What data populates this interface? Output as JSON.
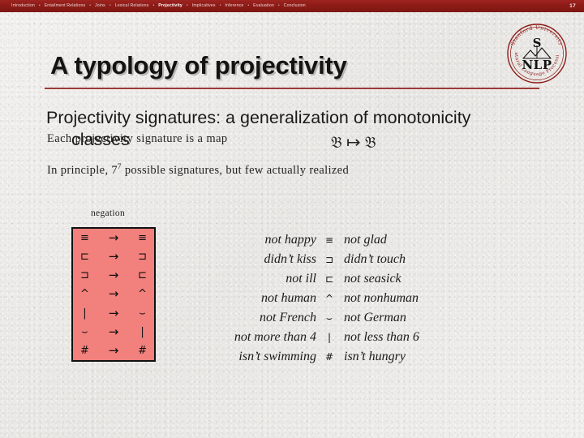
{
  "topbar": {
    "nav_items": [
      {
        "label": "Introduction",
        "active": false
      },
      {
        "label": "Entailment Relations",
        "active": false
      },
      {
        "label": "Joins",
        "active": false
      },
      {
        "label": "Lexical Relations",
        "active": false
      },
      {
        "label": "Projectivity",
        "active": true
      },
      {
        "label": "Implicatives",
        "active": false
      },
      {
        "label": "Inference",
        "active": false
      },
      {
        "label": "Evaluation",
        "active": false
      },
      {
        "label": "Conclusion",
        "active": false
      }
    ],
    "separator": "•",
    "page_number": "17"
  },
  "logo": {
    "name": "stanford-nlp-logo",
    "top_arc_text": "Stanford University",
    "bottom_arc_text": "Natural Language Processing",
    "letter_top": "S",
    "letters_bottom": "NLP"
  },
  "title": "A typology of projectivity",
  "body": {
    "heading_line1": "Projectivity signatures: a generalization of monotonicity",
    "heading_line2": "classes",
    "line_each": "Each projectivity signature is a map",
    "map_left": "𝔅",
    "map_arrow": "↦",
    "map_right": "𝔅",
    "line_principle_pre": "In principle, 7",
    "line_principle_sup": "7",
    "line_principle_post": " possible signatures, but few actually realized"
  },
  "diagram": {
    "label": "negation",
    "box_color": "#f2807c",
    "arrow": "→",
    "rows": [
      {
        "source": "≡",
        "target": "≡"
      },
      {
        "source": "⊏",
        "target": "⊐"
      },
      {
        "source": "⊐",
        "target": "⊏"
      },
      {
        "source": "^",
        "target": "^"
      },
      {
        "source": "|",
        "target": "⌣"
      },
      {
        "source": "⌣",
        "target": "|"
      },
      {
        "source": "#",
        "target": "#"
      }
    ]
  },
  "examples": {
    "rows": [
      {
        "relation": "≡",
        "left": "not happy",
        "right": "not glad"
      },
      {
        "relation": "⊐",
        "left": "didn’t kiss",
        "right": "didn’t touch"
      },
      {
        "relation": "⊏",
        "left": "not ill",
        "right": "not seasick"
      },
      {
        "relation": "^",
        "left": "not human",
        "right": "not nonhuman"
      },
      {
        "relation": "⌣",
        "left": "not French",
        "right": "not German"
      },
      {
        "relation": "|",
        "left": "not more than 4",
        "right": "not less than 6"
      },
      {
        "relation": "#",
        "left": "isn’t swimming",
        "right": "isn’t hungry"
      }
    ]
  },
  "colors": {
    "bar": "#8d1b17",
    "rule": "#9c3a3a",
    "box": "#f2807c",
    "background": "#eeecea"
  }
}
